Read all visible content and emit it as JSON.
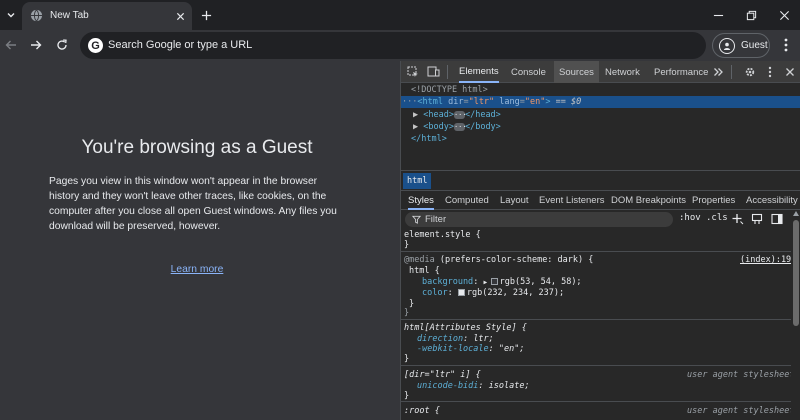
{
  "tabstrip": {
    "tab_title": "New Tab"
  },
  "toolbar": {
    "omnibox_placeholder": "Search Google or type a URL",
    "omnibox_g": "G",
    "profile_label": "Guest"
  },
  "page": {
    "heading": "You're browsing as a Guest",
    "body": "Pages you view in this window won't appear in the browser history and they won't leave other traces, like cookies, on the computer after you close all open Guest windows. Any files you download will be preserved, however.",
    "learn_more": "Learn more"
  },
  "devtools": {
    "tabs": [
      "Elements",
      "Console",
      "Sources",
      "Network",
      "Performance"
    ],
    "dom": {
      "doctype": "<!DOCTYPE html>",
      "html_open_tag": "html",
      "html_dir_attr": "dir",
      "html_dir_val": "\"ltr\"",
      "html_lang_attr": "lang",
      "html_lang_val": "\"en\"",
      "html_eq": "== $0",
      "head_open": "<head>",
      "head_close": "</head>",
      "body_open": "<body>",
      "body_close": "</body>",
      "html_close": "</html>"
    },
    "breadcrumb": "html",
    "sub_tabs": [
      "Styles",
      "Computed",
      "Layout",
      "Event Listeners",
      "DOM Breakpoints",
      "Properties",
      "Accessibility"
    ],
    "filter_placeholder": "Filter",
    "hov": ":hov",
    "cls": ".cls",
    "styles": {
      "element_style": "element.style {",
      "close_brace": "}",
      "media_at": "@media",
      "media_query": "(prefers-color-scheme: dark) {",
      "media_source": "(index):19",
      "media_selector": "html {",
      "background_prop": "background",
      "background_val": "rgb(53, 54, 58);",
      "color_prop": "color",
      "color_val": "rgb(232, 234, 237);",
      "attr_selector": "html[Attributes Style] {",
      "direction_prop": "direction",
      "direction_val": "ltr;",
      "locale_prop": "-webkit-locale",
      "locale_val": "\"en\";",
      "dir_selector": "[dir=\"ltr\" i] {",
      "ua_label": "user agent stylesheet",
      "unicode_prop": "unicode-bidi",
      "unicode_val": "isolate;",
      "root_selector": ":root {"
    }
  },
  "colors": {
    "page_bg": "#35363a",
    "tabstrip_bg": "#202124",
    "link": "#8ab4f8",
    "devtools_bg": "#282828",
    "selection": "#1a508b"
  }
}
